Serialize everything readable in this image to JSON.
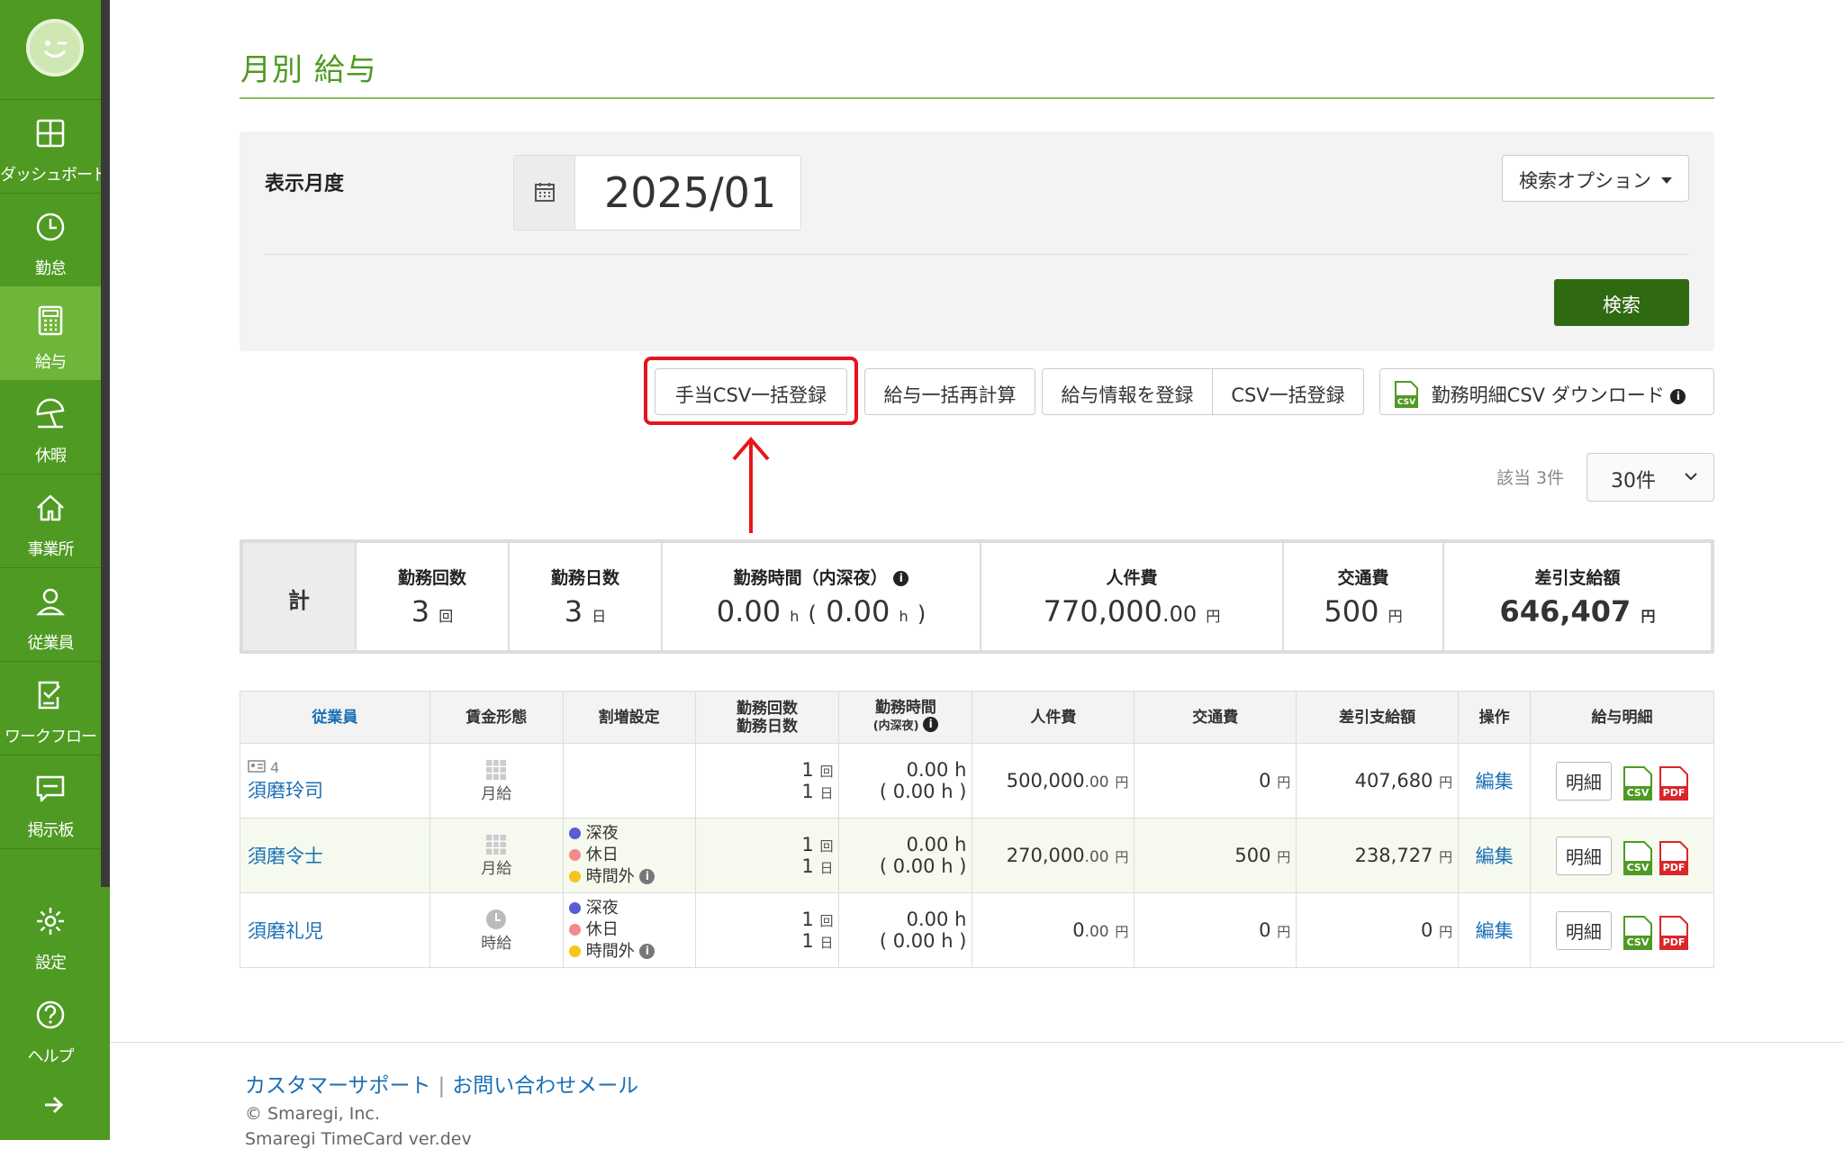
{
  "sidebar": {
    "items": [
      {
        "label": "ダッシュボード",
        "icon": "dashboard-icon"
      },
      {
        "label": "勤怠",
        "icon": "clock-icon"
      },
      {
        "label": "給与",
        "icon": "calculator-icon"
      },
      {
        "label": "休暇",
        "icon": "beach-umbrella-icon"
      },
      {
        "label": "事業所",
        "icon": "home-icon"
      },
      {
        "label": "従業員",
        "icon": "user-icon"
      },
      {
        "label": "ワークフロー",
        "icon": "checklist-icon"
      },
      {
        "label": "掲示板",
        "icon": "chat-icon"
      }
    ],
    "bottom": [
      {
        "label": "設定",
        "icon": "gear-icon"
      },
      {
        "label": "ヘルプ",
        "icon": "help-icon"
      }
    ],
    "active_color": "#6db63a",
    "bg_color": "#4f9a22"
  },
  "page": {
    "title": "月別 給与"
  },
  "filter": {
    "month_label": "表示月度",
    "month_value": "2025/01",
    "options_label": "検索オプション",
    "search_label": "検索"
  },
  "toolbar": {
    "allowance_csv": "手当CSV一括登録",
    "recalc": "給与一括再計算",
    "register_info": "給与情報を登録",
    "csv_bulk": "CSV一括登録",
    "download": "勤務明細CSV ダウンロード"
  },
  "pagination": {
    "count": "該当 3件",
    "per_page": "30件"
  },
  "summary": {
    "label": "計",
    "work_count_h": "勤務回数",
    "work_count_v": "3",
    "work_count_u": "回",
    "work_days_h": "勤務日数",
    "work_days_v": "3",
    "work_days_u": "日",
    "work_hours_h": "勤務時間（内深夜）",
    "work_hours_v": "0.00",
    "work_hours_night": "0.00",
    "h_unit": "h",
    "paren_open": "(",
    "paren_close": ")",
    "labor_h": "人件費",
    "labor_v": "770,000",
    "labor_dec": ".00",
    "yen": "円",
    "transport_h": "交通費",
    "transport_v": "500",
    "net_h": "差引支給額",
    "net_v": "646,407"
  },
  "table": {
    "headers": {
      "employee": "従業員",
      "wage_type": "賃金形態",
      "premium": "割増設定",
      "count1": "勤務回数",
      "count2": "勤務日数",
      "hours1": "勤務時間",
      "hours2": "(内深夜)",
      "labor": "人件費",
      "transport": "交通費",
      "net": "差引支給額",
      "ops": "操作",
      "slip": "給与明細"
    },
    "labels": {
      "night": "深夜",
      "holiday": "休日",
      "overtime": "時間外",
      "kai": "回",
      "nichi": "日",
      "h": "h",
      "yen": "円",
      "edit": "編集",
      "detail": "明細"
    },
    "rows": [
      {
        "id": "4",
        "name": "須磨玲司",
        "wage": "月給",
        "count": "1",
        "days": "1",
        "hours": "0.00",
        "night": "( 0.00 h )",
        "labor": "500,000",
        "labor_dec": ".00",
        "transport": "0",
        "net": "407,680"
      },
      {
        "id": "",
        "name": "須磨令士",
        "wage": "月給",
        "count": "1",
        "days": "1",
        "hours": "0.00",
        "night": "( 0.00 h )",
        "labor": "270,000",
        "labor_dec": ".00",
        "transport": "500",
        "net": "238,727"
      },
      {
        "id": "",
        "name": "須磨礼児",
        "wage": "時給",
        "count": "1",
        "days": "1",
        "hours": "0.00",
        "night": "( 0.00 h )",
        "labor": "0",
        "labor_dec": ".00",
        "transport": "0",
        "net": "0"
      }
    ],
    "dot_colors": {
      "night": "#5b5bd6",
      "holiday": "#f28b8b",
      "overtime": "#f5c518"
    }
  },
  "footer": {
    "support": "カスタマーサポート",
    "sep": "|",
    "contact": "お問い合わせメール",
    "copyright": "© Smaregi, Inc.",
    "version": "Smaregi TimeCard ver.dev"
  }
}
